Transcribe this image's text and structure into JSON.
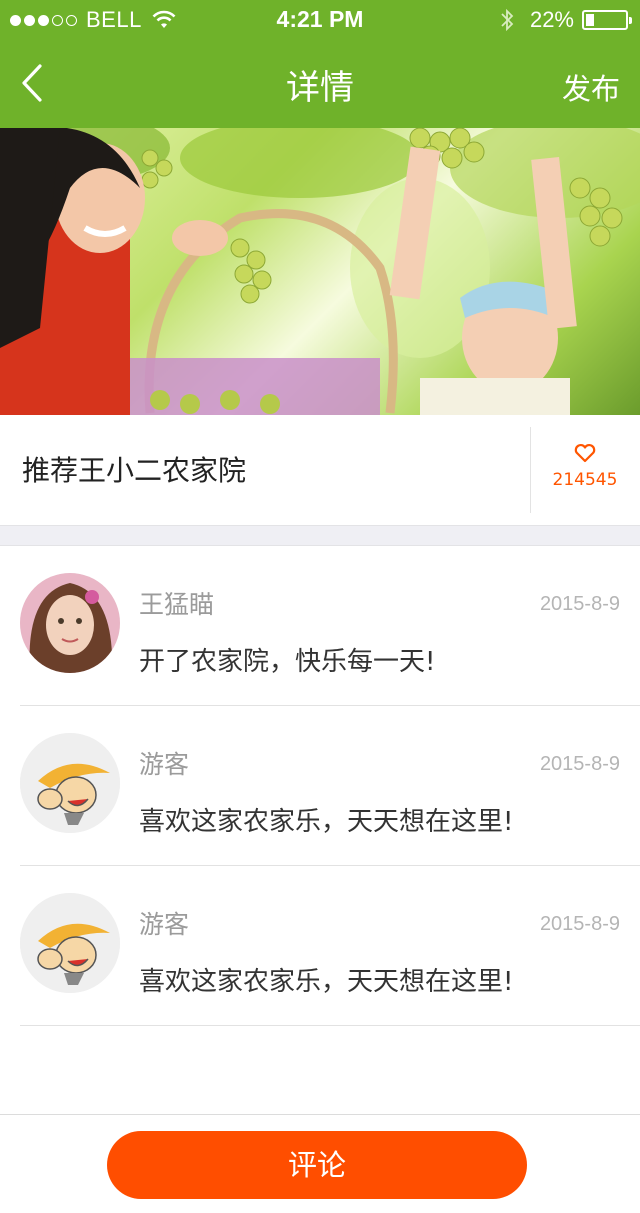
{
  "status_bar": {
    "carrier": "BELL",
    "signal_filled": 3,
    "signal_total": 5,
    "time": "4:21 PM",
    "battery": "22%",
    "battery_level": 0.22
  },
  "nav": {
    "back_icon": "chevron-left-icon",
    "title": "详情",
    "publish_label": "发布"
  },
  "colors": {
    "nav_green": "#6fb22a",
    "accent_orange": "#ff4e00",
    "likes_orange": "#ff5500"
  },
  "detail": {
    "title": "推荐王小二农家院",
    "like_icon": "heart-icon",
    "likes": "214545"
  },
  "comments": [
    {
      "name": "王猛瞄",
      "date": "2015-8-9",
      "text": "开了农家院，快乐每一天!",
      "avatar": "girl-photo"
    },
    {
      "name": "游客",
      "date": "2015-8-9",
      "text": "喜欢这家农家乐，天天想在这里!",
      "avatar": "farmer-cartoon"
    },
    {
      "name": "游客",
      "date": "2015-8-9",
      "text": "喜欢这家农家乐，天天想在这里!",
      "avatar": "farmer-cartoon"
    }
  ],
  "bottom": {
    "comment_label": "评论"
  }
}
